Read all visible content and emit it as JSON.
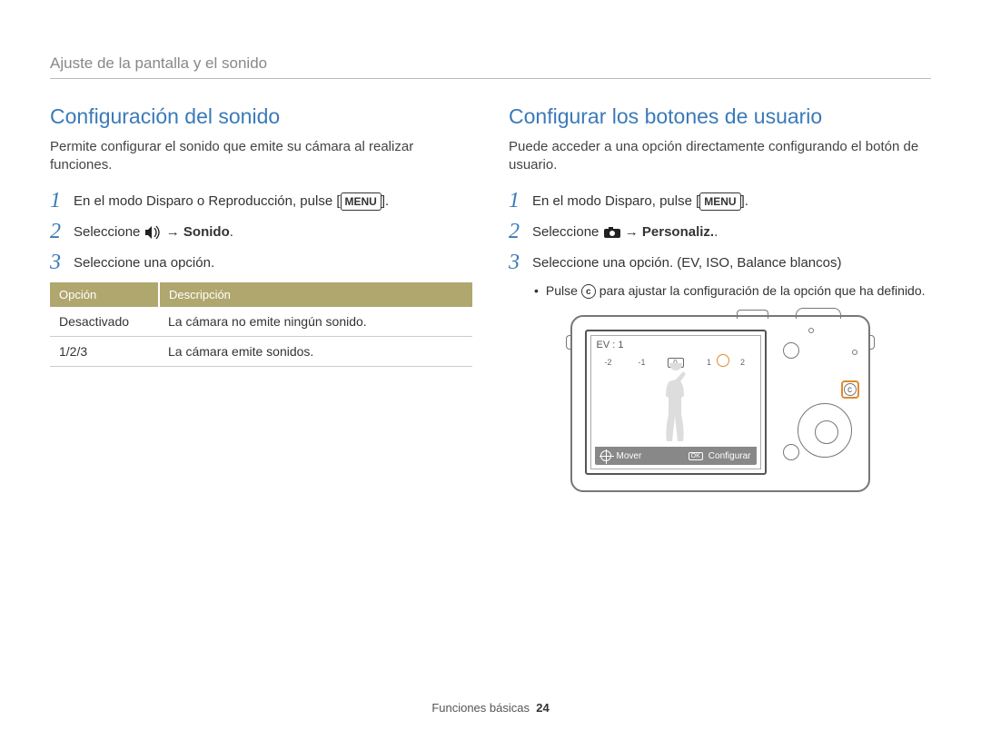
{
  "header": "Ajuste de la pantalla y el sonido",
  "left": {
    "title": "Configuración del sonido",
    "intro": "Permite configurar el sonido que emite su cámara al realizar funciones.",
    "step1_a": "En el modo Disparo o Reproducción, pulse [",
    "step1_menu": "MENU",
    "step1_b": "].",
    "step2_a": "Seleccione ",
    "step2_arrow": " → ",
    "step2_bold": "Sonido",
    "step2_end": ".",
    "step3": "Seleccione una opción.",
    "th1": "Opción",
    "th2": "Descripción",
    "r1c1": "Desactivado",
    "r1c2": "La cámara no emite ningún sonido.",
    "r2c1": "1/2/3",
    "r2c2": "La cámara emite sonidos."
  },
  "right": {
    "title": "Configurar los botones de usuario",
    "intro": "Puede acceder a una opción directamente configurando el botón de usuario.",
    "step1_a": "En el modo Disparo, pulse [",
    "step1_menu": "MENU",
    "step1_b": "].",
    "step2_a": "Seleccione ",
    "step2_arrow": " → ",
    "step2_bold": "Personaliz.",
    "step2_end": ".",
    "step3": "Seleccione una opción. (EV, ISO, Balance blancos)",
    "bullet_a": "Pulse ",
    "bullet_c": "c",
    "bullet_b": " para ajustar la configuración de la opción que ha definido.",
    "screen": {
      "ev": "EV : 1",
      "ticks": [
        "-2",
        "-1",
        "0",
        "1",
        "2"
      ],
      "mover": "Mover",
      "ok": "OK",
      "configurar": "Configurar"
    }
  },
  "footer": {
    "section": "Funciones básicas",
    "page": "24"
  }
}
